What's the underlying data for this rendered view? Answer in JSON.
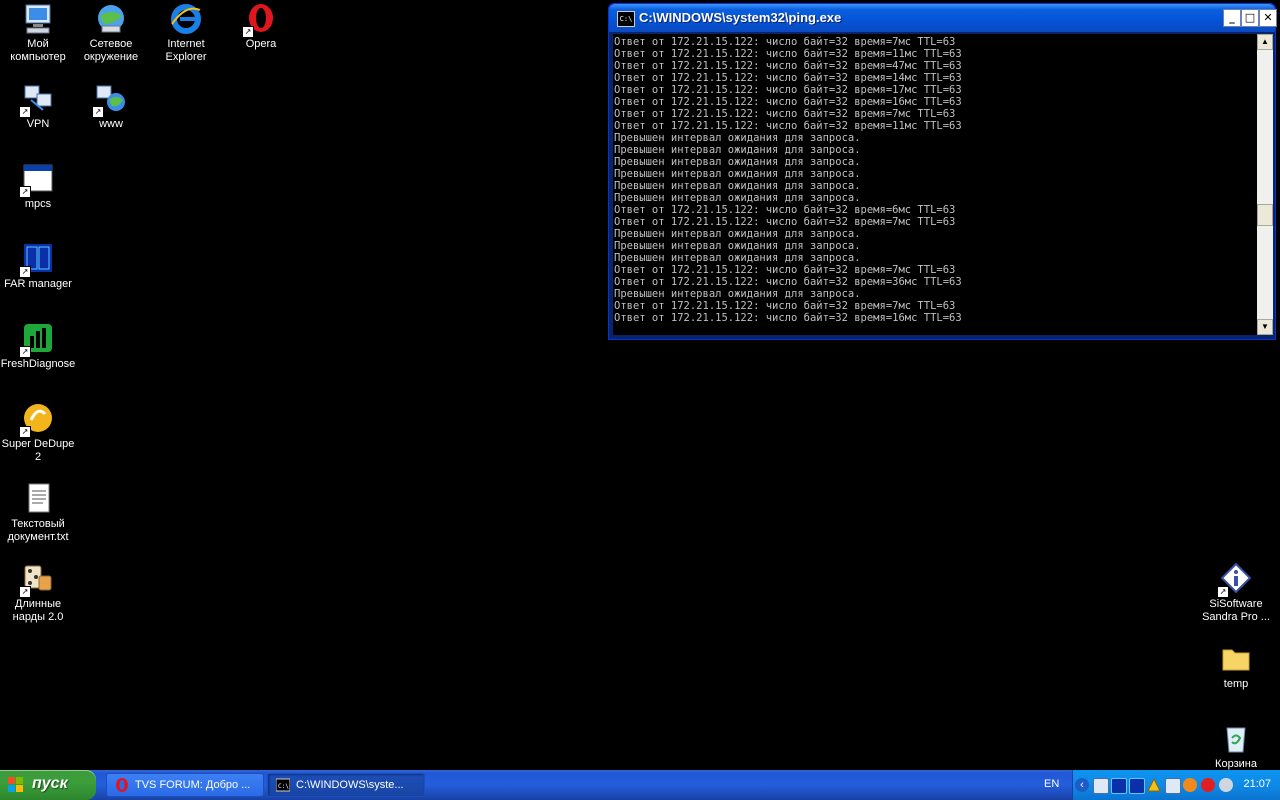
{
  "desktop": {
    "icons_left": [
      {
        "name": "my-computer-icon",
        "label": "Мой\nкомпьютер"
      },
      {
        "name": "network-icon",
        "label": "Сетевое\nокружение"
      },
      {
        "name": "internet-explorer-icon",
        "label": "Internet\nExplorer"
      },
      {
        "name": "opera-icon",
        "label": "Opera"
      },
      {
        "name": "vpn-icon",
        "label": "VPN"
      },
      {
        "name": "www-icon",
        "label": "www"
      },
      {
        "name": "mpcs-icon",
        "label": "mpcs"
      },
      {
        "name": "far-manager-icon",
        "label": "FAR manager"
      },
      {
        "name": "freshdiagnose-icon",
        "label": "FreshDiagnose"
      },
      {
        "name": "super-dedupe-icon",
        "label": "Super DeDupe\n2"
      },
      {
        "name": "text-document-icon",
        "label": "Текстовый\nдокумент.txt"
      },
      {
        "name": "backgammon-icon",
        "label": "Длинные\nнарды 2.0"
      }
    ],
    "icons_right": [
      {
        "name": "sisoftware-sandra-icon",
        "label": "SiSoftware\nSandra Pro ..."
      },
      {
        "name": "temp-folder-icon",
        "label": "temp"
      },
      {
        "name": "recycle-bin-icon",
        "label": "Корзина"
      }
    ]
  },
  "console_window": {
    "title": "C:\\WINDOWS\\system32\\ping.exe",
    "lines": [
      "Ответ от 172.21.15.122: число байт=32 время=7мс TTL=63",
      "Ответ от 172.21.15.122: число байт=32 время=11мс TTL=63",
      "Ответ от 172.21.15.122: число байт=32 время=47мс TTL=63",
      "Ответ от 172.21.15.122: число байт=32 время=14мс TTL=63",
      "Ответ от 172.21.15.122: число байт=32 время=17мс TTL=63",
      "Ответ от 172.21.15.122: число байт=32 время=16мс TTL=63",
      "Ответ от 172.21.15.122: число байт=32 время=7мс TTL=63",
      "Ответ от 172.21.15.122: число байт=32 время=11мс TTL=63",
      "Превышен интервал ожидания для запроса.",
      "Превышен интервал ожидания для запроса.",
      "Превышен интервал ожидания для запроса.",
      "Превышен интервал ожидания для запроса.",
      "Превышен интервал ожидания для запроса.",
      "Превышен интервал ожидания для запроса.",
      "Ответ от 172.21.15.122: число байт=32 время=6мс TTL=63",
      "Ответ от 172.21.15.122: число байт=32 время=7мс TTL=63",
      "Превышен интервал ожидания для запроса.",
      "Превышен интервал ожидания для запроса.",
      "Превышен интервал ожидания для запроса.",
      "Ответ от 172.21.15.122: число байт=32 время=7мс TTL=63",
      "Ответ от 172.21.15.122: число байт=32 время=36мс TTL=63",
      "Превышен интервал ожидания для запроса.",
      "Ответ от 172.21.15.122: число байт=32 время=7мс TTL=63",
      "Ответ от 172.21.15.122: число байт=32 время=16мс TTL=63"
    ],
    "app_icon_text": "C:\\"
  },
  "taskbar": {
    "start_label": "пуск",
    "tasks": [
      {
        "label": "TVS FORUM: Добро ...",
        "icon": "opera-icon",
        "active": false
      },
      {
        "label": "C:\\WINDOWS\\syste...",
        "icon": "console-icon",
        "active": true
      }
    ],
    "language": "EN",
    "clock": "21:07"
  },
  "colors": {
    "desktop_bg": "#000000",
    "console_text": "#c0c0c0",
    "titlebar": "#0553d6"
  }
}
